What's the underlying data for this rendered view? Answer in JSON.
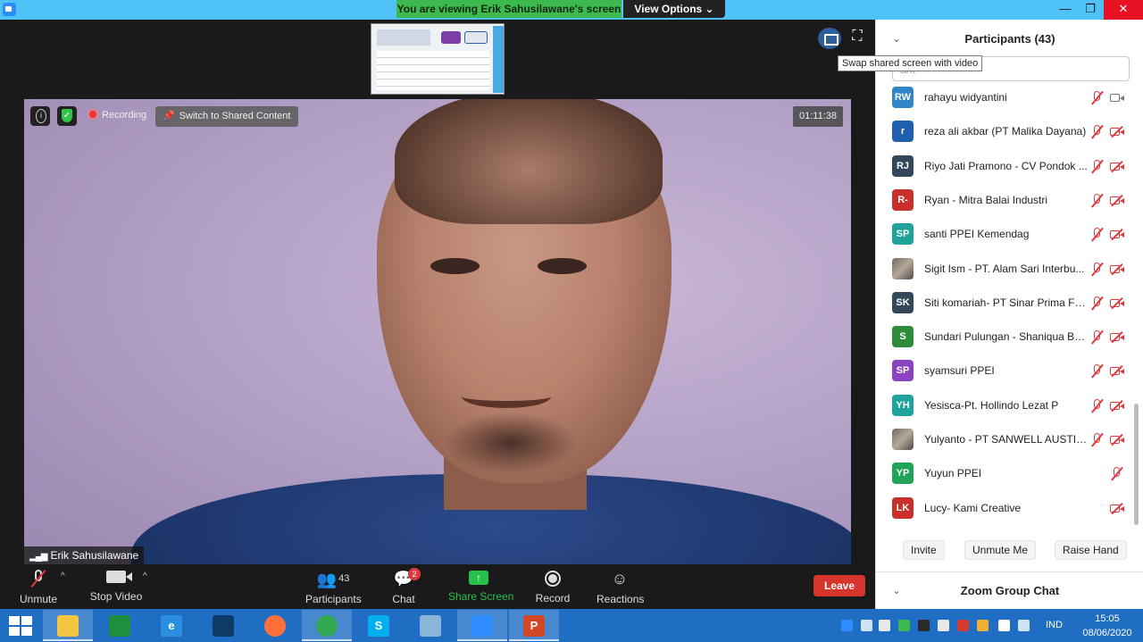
{
  "title_bar": {
    "banner": "You are viewing Erik Sahusilawane's screen",
    "view_options": "View Options ⌄",
    "minimize": "—",
    "maximize": "❐",
    "close": "✕"
  },
  "meeting": {
    "tooltip": "Swap shared screen with video",
    "fullscreen_icon": "⛶",
    "recording": "Recording",
    "switch_shared": "Switch to Shared Content",
    "timer": "01:11:38",
    "speaker_name": "Erik Sahusilawane"
  },
  "toolbar": {
    "unmute": "Unmute",
    "stop_video": "Stop Video",
    "participants": "Participants",
    "participants_count": "43",
    "chat": "Chat",
    "chat_badge": "2",
    "share_screen": "Share Screen",
    "record": "Record",
    "reactions": "Reactions",
    "leave": "Leave"
  },
  "panel": {
    "title": "Participants (43)",
    "search_placeholder": "ant",
    "participants": [
      {
        "initials": "RW",
        "name": "rahayu widyantini",
        "color": "#2f87c9",
        "mic_muted": true,
        "video": "on"
      },
      {
        "initials": "r",
        "name": "reza ali akbar (PT Malika Dayana)",
        "color": "#1f5fb0",
        "mic_muted": true,
        "video": "off"
      },
      {
        "initials": "RJ",
        "name": "Riyo Jati Pramono - CV Pondok ...",
        "color": "#33475b",
        "mic_muted": true,
        "video": "off"
      },
      {
        "initials": "R-",
        "name": "Ryan - Mitra Balai Industri",
        "color": "#c9302c",
        "mic_muted": true,
        "video": "off"
      },
      {
        "initials": "SP",
        "name": "santi PPEI Kemendag",
        "color": "#1fa39a",
        "mic_muted": true,
        "video": "off"
      },
      {
        "initials": "",
        "name": "Sigit Ism - PT. Alam Sari Interbu...",
        "color": "photo",
        "mic_muted": true,
        "video": "off"
      },
      {
        "initials": "SK",
        "name": "Siti komariah- PT Sinar Prima Fo...",
        "color": "#33475b",
        "mic_muted": true,
        "video": "off"
      },
      {
        "initials": "S",
        "name": "Sundari Pulungan - Shaniqua Ba...",
        "color": "#2e8b3a",
        "mic_muted": true,
        "video": "off"
      },
      {
        "initials": "SP",
        "name": "syamsuri PPEI",
        "color": "#8a44c2",
        "mic_muted": true,
        "video": "off"
      },
      {
        "initials": "YH",
        "name": "Yesisca-Pt. Hollindo Lezat P",
        "color": "#1fa39a",
        "mic_muted": true,
        "video": "off"
      },
      {
        "initials": "",
        "name": "Yulyanto - PT SANWELL AUSTIN...",
        "color": "photo",
        "mic_muted": true,
        "video": "off"
      },
      {
        "initials": "YP",
        "name": "Yuyun PPEI",
        "color": "#22a35a",
        "mic_muted": true,
        "video": "none"
      },
      {
        "initials": "LK",
        "name": "Lucy- Kami Creative",
        "color": "#c9302c",
        "mic_muted": false,
        "video": "off"
      }
    ],
    "invite": "Invite",
    "unmute_me": "Unmute Me",
    "raise_hand": "Raise Hand",
    "chat_title": "Zoom Group Chat"
  },
  "taskbar": {
    "apps": [
      {
        "name": "file-explorer",
        "glyph": "",
        "color": "#f5c542",
        "active": true
      },
      {
        "name": "store",
        "glyph": "",
        "color": "#1e8f3e",
        "active": false
      },
      {
        "name": "internet-explorer",
        "glyph": "e",
        "color": "#2a8fe0",
        "active": false
      },
      {
        "name": "app-window",
        "glyph": "",
        "color": "#0d3b66",
        "active": false
      },
      {
        "name": "firefox",
        "glyph": "",
        "color": "#ff7139",
        "active": false
      },
      {
        "name": "chrome",
        "glyph": "",
        "color": "#34a853",
        "active": true
      },
      {
        "name": "skype",
        "glyph": "S",
        "color": "#00aff0",
        "active": false
      },
      {
        "name": "notes",
        "glyph": "",
        "color": "#8ab4d8",
        "active": false
      },
      {
        "name": "zoom",
        "glyph": "",
        "color": "#2d8cff",
        "active": true
      },
      {
        "name": "powerpoint",
        "glyph": "P",
        "color": "#d24726",
        "active": true
      }
    ],
    "ime": "IND",
    "time": "15:05",
    "date": "08/06/2020"
  }
}
